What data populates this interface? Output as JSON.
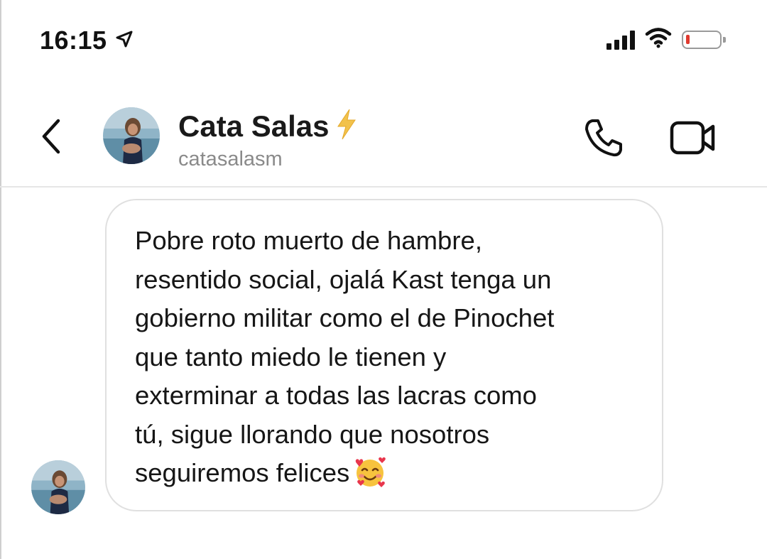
{
  "status_bar": {
    "time": "16:15",
    "icons": [
      "location-arrow-icon",
      "signal-bars-icon",
      "wifi-icon",
      "battery-low-icon"
    ],
    "battery_color": "#e03a2f"
  },
  "header": {
    "back_icon": "chevron-left-icon",
    "name": "Cata Salas",
    "name_badge_icon": "lightning-bolt-icon",
    "badge_color": "#f2c24b",
    "username": "catasalasm",
    "call_icon": "phone-icon",
    "video_icon": "video-camera-icon"
  },
  "messages": [
    {
      "sender": "catasalasm",
      "text": "Pobre roto muerto de hambre,\nresentido social, ojalá Kast tenga un\ngobierno militar como el de Pinochet\nque tanto miedo le tienen y\nexterminar a todas las lacras como\ntú, sigue llorando que nosotros\nseguiremos felices",
      "trailing_emoji": "smiling-face-with-hearts"
    }
  ]
}
